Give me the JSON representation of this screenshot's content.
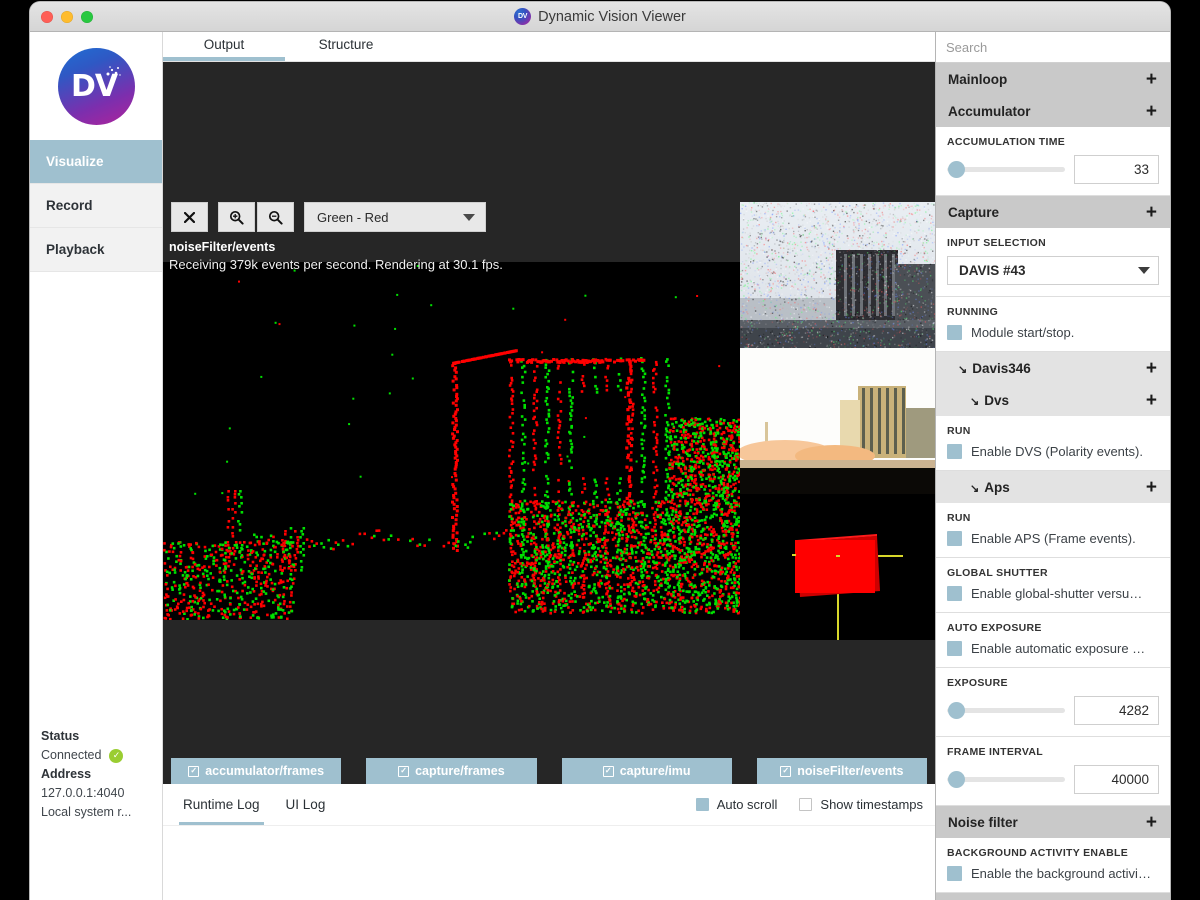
{
  "window": {
    "title": "Dynamic Vision Viewer",
    "badge_text": "DV",
    "traffic_lights": [
      "close-button",
      "minimize-button",
      "maximize-button"
    ]
  },
  "sidebar": {
    "logo_text": "DV",
    "items": [
      {
        "label": "Visualize",
        "active": true
      },
      {
        "label": "Record",
        "active": false
      },
      {
        "label": "Playback",
        "active": false
      }
    ],
    "status": {
      "status_key": "Status",
      "status_value": "Connected",
      "status_icon": "check-circle-icon",
      "address_key": "Address",
      "address_value": "127.0.0.1:4040",
      "address_note": "Local system r..."
    }
  },
  "main": {
    "tabs": [
      {
        "label": "Output",
        "active": true
      },
      {
        "label": "Structure",
        "active": false
      }
    ],
    "viewer": {
      "toolbar": {
        "close_label": "✖",
        "zoom_in_label": "⊕",
        "zoom_out_label": "⊖",
        "colormap_value": "Green - Red"
      },
      "overlay_title": "noiseFilter/events",
      "overlay_status": "Receiving 379k events per second. Rendering at 30.1 fps.",
      "event_colors": {
        "positive": "#00e000",
        "negative": "#ff0000",
        "background": "#000000"
      },
      "thumbnails": [
        {
          "name": "noise-events-preview"
        },
        {
          "name": "aps-frame-preview"
        },
        {
          "name": "imu-orientation-preview"
        }
      ]
    },
    "module_tabs": [
      {
        "label": "accumulator/frames",
        "checked": true
      },
      {
        "label": "capture/frames",
        "checked": true
      },
      {
        "label": "capture/imu",
        "checked": true
      },
      {
        "label": "noiseFilter/events",
        "checked": true
      }
    ],
    "log": {
      "tabs": [
        {
          "label": "Runtime Log",
          "active": true
        },
        {
          "label": "UI Log",
          "active": false
        }
      ],
      "options": [
        {
          "label": "Auto scroll",
          "checked": true
        },
        {
          "label": "Show timestamps",
          "checked": false
        }
      ]
    }
  },
  "right_panel": {
    "search_placeholder": "Search",
    "sections": [
      {
        "kind": "header",
        "title": "Mainloop",
        "level": 0,
        "expander": "+"
      },
      {
        "kind": "header",
        "title": "Accumulator",
        "level": 0,
        "expander": "+"
      },
      {
        "kind": "slider",
        "label": "ACCUMULATION TIME",
        "value": "33"
      },
      {
        "kind": "header",
        "title": "Capture",
        "level": 0,
        "expander": "+"
      },
      {
        "kind": "select",
        "label": "INPUT SELECTION",
        "value": "DAVIS #43"
      },
      {
        "kind": "checkbox",
        "label": "RUNNING",
        "text": "Module start/stop.",
        "checked": true
      },
      {
        "kind": "header",
        "title": "Davis346",
        "level": 1,
        "expander": "+",
        "arrow": "↘"
      },
      {
        "kind": "header",
        "title": "Dvs",
        "level": 2,
        "expander": "+",
        "arrow": "↘"
      },
      {
        "kind": "checkbox",
        "label": "RUN",
        "text": "Enable DVS (Polarity events).",
        "checked": true
      },
      {
        "kind": "header",
        "title": "Aps",
        "level": 2,
        "expander": "+",
        "arrow": "↘"
      },
      {
        "kind": "checkbox",
        "label": "RUN",
        "text": "Enable APS (Frame events).",
        "checked": true
      },
      {
        "kind": "checkbox",
        "label": "GLOBAL SHUTTER",
        "text": "Enable global-shutter versu…",
        "checked": true
      },
      {
        "kind": "checkbox",
        "label": "AUTO EXPOSURE",
        "text": "Enable automatic exposure …",
        "checked": true
      },
      {
        "kind": "slider",
        "label": "EXPOSURE",
        "value": "4282"
      },
      {
        "kind": "slider",
        "label": "FRAME INTERVAL",
        "value": "40000"
      },
      {
        "kind": "header",
        "title": "Noise filter",
        "level": 0,
        "expander": "+"
      },
      {
        "kind": "checkbox",
        "label": "BACKGROUND ACTIVITY ENABLE",
        "text": "Enable the background activi…",
        "checked": true
      }
    ]
  },
  "colors": {
    "accent": "#9fc0cf",
    "panel_bg": "#c9c9c9",
    "viewer_bg": "#262626",
    "event_positive": "#00e000",
    "event_negative": "#ff0000"
  }
}
